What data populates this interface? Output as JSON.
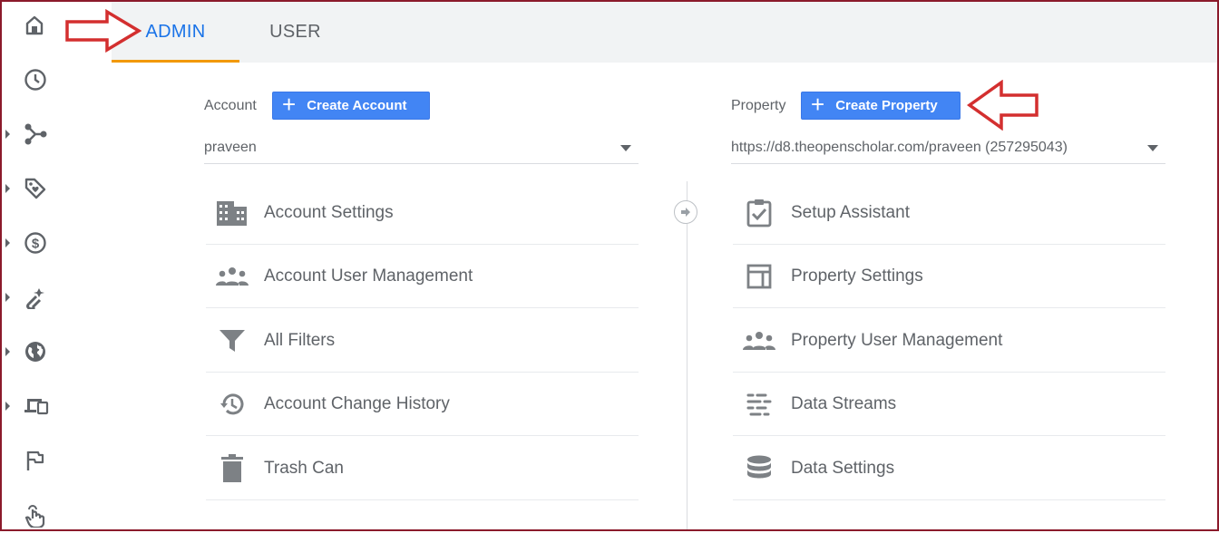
{
  "nav": {
    "items": [
      {
        "name": "home-icon",
        "caret": false
      },
      {
        "name": "clock-icon",
        "caret": false
      },
      {
        "name": "share-icon",
        "caret": true
      },
      {
        "name": "tag-icon",
        "caret": true
      },
      {
        "name": "dollar-icon",
        "caret": true
      },
      {
        "name": "magnet-icon",
        "caret": true
      },
      {
        "name": "globe-icon",
        "caret": true
      },
      {
        "name": "devices-icon",
        "caret": true
      },
      {
        "name": "flag-icon",
        "caret": false
      },
      {
        "name": "touch-icon",
        "caret": false
      }
    ]
  },
  "tabs": {
    "admin": "ADMIN",
    "user": "USER",
    "active": "admin"
  },
  "account": {
    "label": "Account",
    "create_button": "Create Account",
    "selected": "praveen",
    "items": [
      {
        "label": "Account Settings",
        "icon": "building-icon"
      },
      {
        "label": "Account User Management",
        "icon": "people-icon"
      },
      {
        "label": "All Filters",
        "icon": "filter-icon"
      },
      {
        "label": "Account Change History",
        "icon": "history-icon"
      },
      {
        "label": "Trash Can",
        "icon": "trash-icon"
      }
    ]
  },
  "property": {
    "label": "Property",
    "create_button": "Create Property",
    "selected": "https://d8.theopenscholar.com/praveen (257295043)",
    "items": [
      {
        "label": "Setup Assistant",
        "icon": "clipboard-check-icon"
      },
      {
        "label": "Property Settings",
        "icon": "layout-icon"
      },
      {
        "label": "Property User Management",
        "icon": "people-icon"
      },
      {
        "label": "Data Streams",
        "icon": "streams-icon"
      },
      {
        "label": "Data Settings",
        "icon": "database-icon"
      }
    ]
  },
  "colors": {
    "accent": "#1a73e8",
    "button": "#4285f4",
    "tab_underline": "#f29900",
    "annotation": "#d32f2f",
    "frame": "#8b1a2b"
  }
}
